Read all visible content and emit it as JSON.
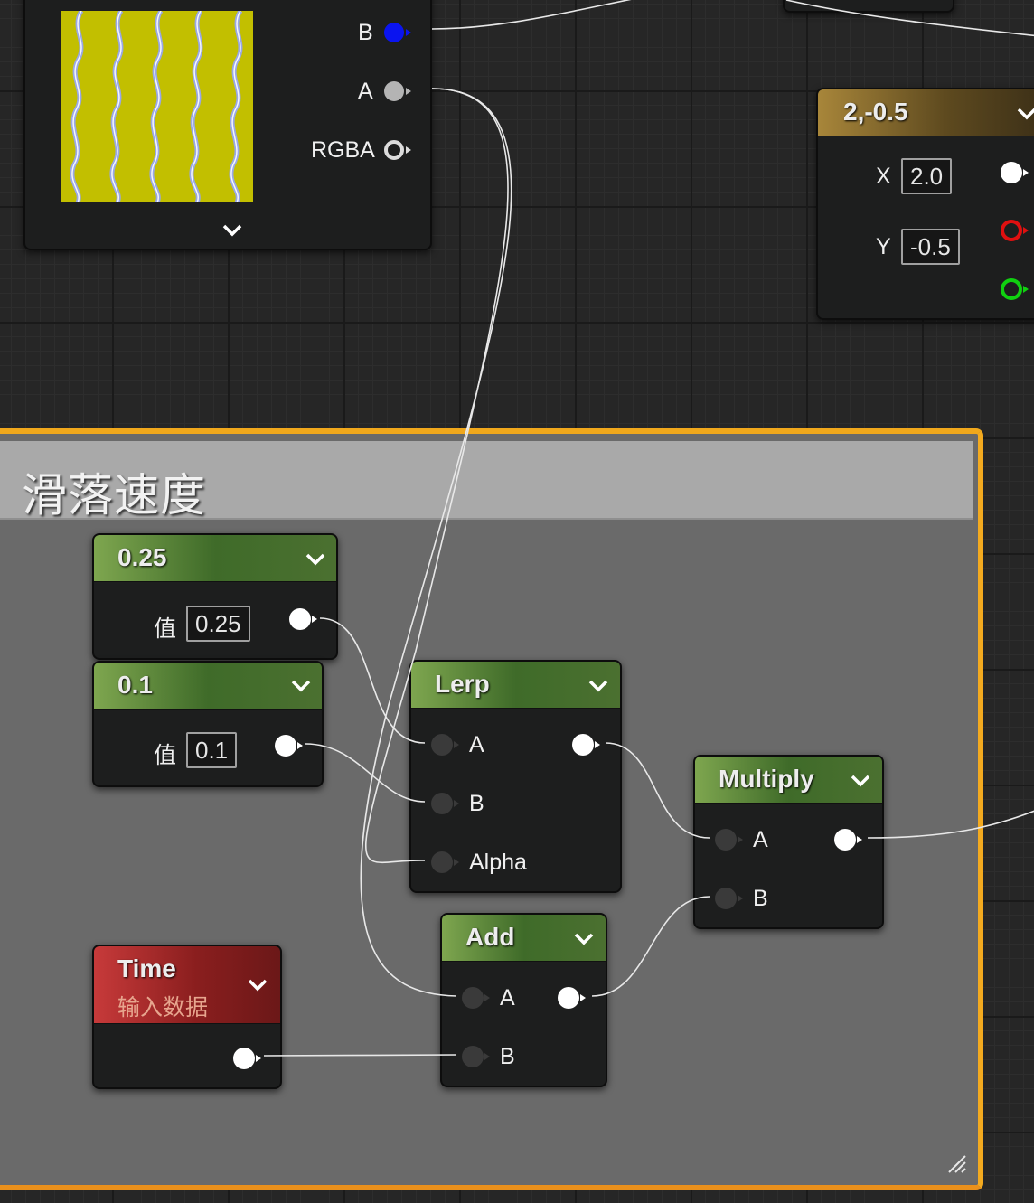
{
  "texture_node": {
    "outputs": [
      "B",
      "A",
      "RGBA"
    ]
  },
  "vector_node": {
    "title": "2,-0.5",
    "x_label": "X",
    "x_value": "2.0",
    "y_label": "Y",
    "y_value": "-0.5"
  },
  "comment": {
    "title": "滑落速度"
  },
  "const_025": {
    "title": "0.25",
    "value_label": "值",
    "value": "0.25"
  },
  "const_01": {
    "title": "0.1",
    "value_label": "值",
    "value": "0.1"
  },
  "lerp": {
    "title": "Lerp",
    "inputs": [
      "A",
      "B",
      "Alpha"
    ]
  },
  "multiply": {
    "title": "Multiply",
    "inputs": [
      "A",
      "B"
    ]
  },
  "add": {
    "title": "Add",
    "inputs": [
      "A",
      "B"
    ]
  },
  "time": {
    "title": "Time",
    "subtitle": "输入数据"
  },
  "colors": {
    "background": "#262626",
    "comment_border": "#f0a81c",
    "constant_header": "#7ea64f",
    "time_header": "#c73a3a",
    "vector_header": "#a8863a"
  }
}
